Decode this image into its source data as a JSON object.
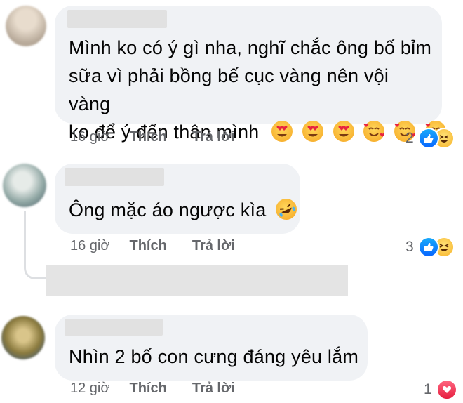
{
  "comments": [
    {
      "text_lines": [
        "Mình ko có ý gì nha, nghĩ chắc ông bố bỉm",
        "sữa vì phải bồng bế cục vàng nên vội vàng",
        "ko để ý đến thân mình"
      ],
      "emojis": [
        "heart-eyes",
        "heart-eyes",
        "heart-eyes",
        "smiling-hearts",
        "smiling-hearts",
        "smiling-hearts"
      ],
      "time": "16 giờ",
      "like_label": "Thích",
      "reply_label": "Trả lời",
      "reaction_count": "2",
      "reactions": [
        "like",
        "haha"
      ]
    },
    {
      "text_lines": [
        "Ông mặc áo ngược kìa"
      ],
      "emojis": [
        "rofl"
      ],
      "time": "16 giờ",
      "like_label": "Thích",
      "reply_label": "Trả lời",
      "reaction_count": "3",
      "reactions": [
        "like",
        "haha"
      ]
    },
    {
      "text_lines": [
        "Nhìn 2 bố con cưng đáng yêu lắm"
      ],
      "emojis": [],
      "time": "12 giờ",
      "like_label": "Thích",
      "reply_label": "Trả lời",
      "reaction_count": "1",
      "reactions": [
        "love"
      ]
    }
  ],
  "colors": {
    "bubble": "#f0f2f5",
    "meta_text": "#65676b",
    "like_blue": "#0866ff",
    "haha_yellow": "#f7b125",
    "love_red": "#e61e3f"
  }
}
